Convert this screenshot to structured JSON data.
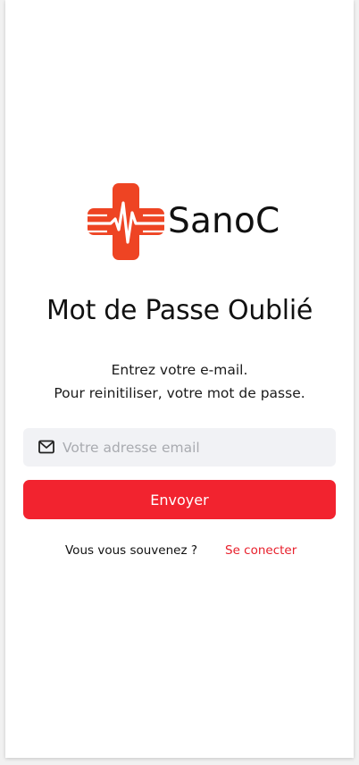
{
  "brand": {
    "name": "SanoC",
    "accent_color": "#f2232f",
    "logo_icon": "medical-cross-heartbeat-icon"
  },
  "page": {
    "title": "Mot de Passe Oublié",
    "subtitle_line1": "Entrez votre e-mail.",
    "subtitle_line2": "Pour reinitiliser, votre mot de passe."
  },
  "form": {
    "email_icon": "mail-icon",
    "email_placeholder": "Votre adresse email",
    "email_value": "",
    "submit_label": "Envoyer"
  },
  "footer": {
    "remember_text": "Vous vous souvenez ?",
    "login_link": "Se conecter"
  }
}
